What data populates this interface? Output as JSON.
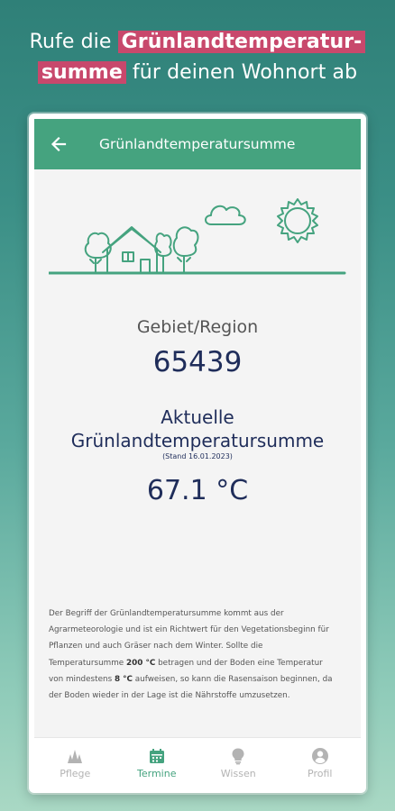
{
  "promo": {
    "line1_pre": "Rufe die ",
    "line1_highlight": "Grünlandtemperatur-",
    "line2_highlight": "summe",
    "line2_post": " für deinen Wohnort ab"
  },
  "appbar": {
    "back_icon": "arrow-left-icon",
    "title": "Grünlandtemperatursumme"
  },
  "region": {
    "label": "Gebiet/Region",
    "value": "65439"
  },
  "current": {
    "title_line1": "Aktuelle",
    "title_line2": "Grünlandtemperatursumme",
    "date": "(Stand 16.01.2023)",
    "value": "67.1 °C"
  },
  "description": {
    "p1": "Der Begriff der Grünlandtemperatursumme kommt aus der Agrarmeteorologie und ist ein Richtwert für den Vegetationsbeginn für Pflanzen und auch Gräser nach dem Winter. Sollte die Temperatursumme ",
    "b1": "200 °C",
    "p2": " betragen und der Boden eine Temperatur von mindestens ",
    "b2": "8 °C",
    "p3": " aufweisen, so kann die Rasensaison beginnen, da der Boden wieder in der Lage ist die Nährstoffe umzusetzen."
  },
  "nav": {
    "items": [
      {
        "label": "Pflege",
        "icon": "grass-icon",
        "active": false
      },
      {
        "label": "Termine",
        "icon": "calendar-icon",
        "active": true
      },
      {
        "label": "Wissen",
        "icon": "lightbulb-icon",
        "active": false
      },
      {
        "label": "Profil",
        "icon": "profile-icon",
        "active": false
      }
    ]
  },
  "colors": {
    "accent": "#45a37f",
    "highlight": "#c8486c",
    "text_dark": "#1f2d5a",
    "nav_inactive": "#b3b3b3"
  }
}
